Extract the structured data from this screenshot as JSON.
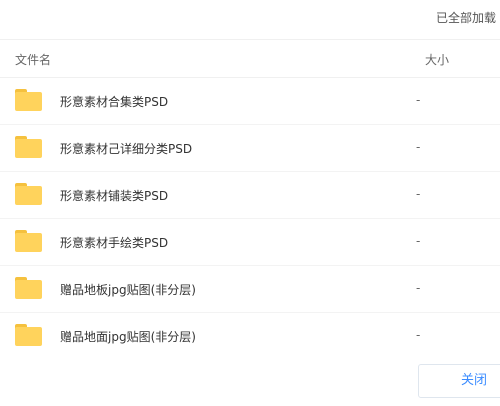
{
  "status": {
    "loaded_text": "已全部加载"
  },
  "table": {
    "headers": {
      "name": "文件名",
      "size": "大小"
    },
    "rows": [
      {
        "name": "形意素材合集类PSD",
        "size": "-",
        "icon": "folder-icon"
      },
      {
        "name": "形意素材己详细分类PSD",
        "size": "-",
        "icon": "folder-icon"
      },
      {
        "name": "形意素材铺装类PSD",
        "size": "-",
        "icon": "folder-icon"
      },
      {
        "name": "形意素材手绘类PSD",
        "size": "-",
        "icon": "folder-icon"
      },
      {
        "name": "赠品地板jpg贴图(非分层)",
        "size": "-",
        "icon": "folder-icon"
      },
      {
        "name": "赠品地面jpg贴图(非分层)",
        "size": "-",
        "icon": "folder-icon"
      }
    ]
  },
  "footer": {
    "close_label": "关闭"
  },
  "colors": {
    "folder": "#ffd35c",
    "accent": "#3b8cff"
  }
}
